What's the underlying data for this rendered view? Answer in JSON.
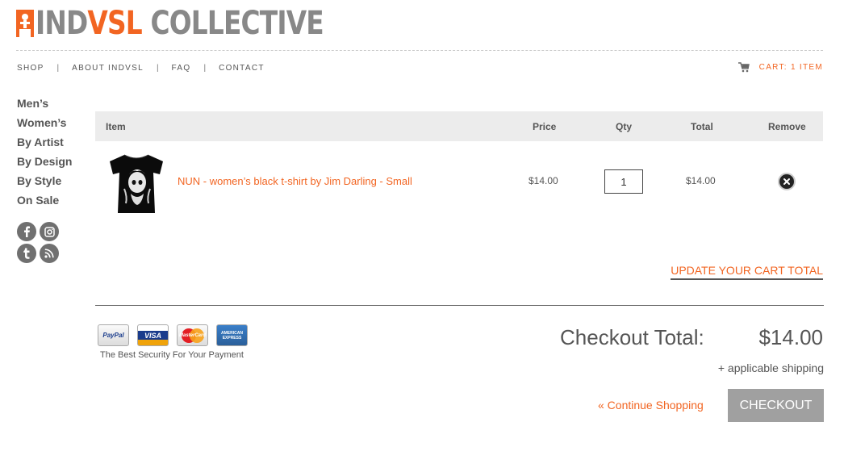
{
  "brand": {
    "ind": "IND",
    "vsl": "VSL",
    "collective": " COLLECTIVE"
  },
  "nav": {
    "shop": "SHOP",
    "about": "ABOUT INDVSL",
    "faq": "FAQ",
    "contact": "CONTACT",
    "separator": "|"
  },
  "cart_link": "CART: 1 ITEM",
  "sidebar": [
    "Men’s",
    "Women’s",
    "By Artist",
    "By Design",
    "By Style",
    "On Sale"
  ],
  "socials": [
    "facebook-icon",
    "instagram-icon",
    "tumblr-icon",
    "rss-icon"
  ],
  "table": {
    "headers": {
      "item": "Item",
      "price": "Price",
      "qty": "Qty",
      "total": "Total",
      "remove": "Remove"
    },
    "rows": [
      {
        "name": "NUN - women’s black t-shirt by Jim Darling - Small",
        "price": "$14.00",
        "qty": "1",
        "total": "$14.00"
      }
    ]
  },
  "update_cart": "UPDATE YOUR CART TOTAL",
  "payments": {
    "paypal": "PayPal",
    "visa": "VISA",
    "mastercard": "MasterCard",
    "amex": "AMERICAN EXPRESS"
  },
  "security_text": "The Best Security For Your Payment",
  "checkout": {
    "label": "Checkout Total:",
    "amount": "$14.00",
    "shipping": "+ applicable shipping",
    "continue": "« Continue Shopping",
    "button": "CHECKOUT"
  },
  "colors": {
    "accent": "#f26522",
    "text": "#555555",
    "header_bg": "#ececec",
    "button_bg": "#a0a0a0"
  }
}
